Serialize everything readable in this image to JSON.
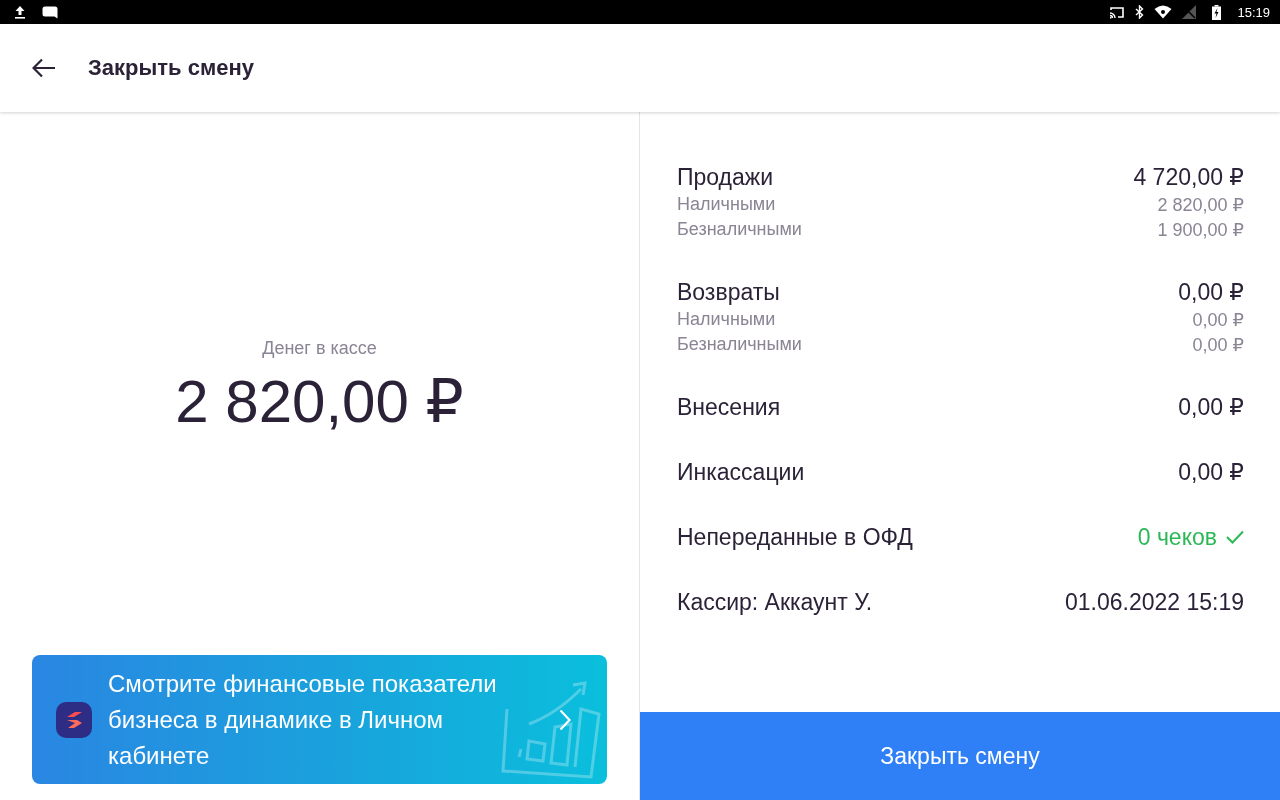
{
  "status_bar": {
    "time": "15:19"
  },
  "header": {
    "title": "Закрыть смену"
  },
  "cash": {
    "label": "Денег в кассе",
    "amount": "2 820,00 ₽"
  },
  "promo": {
    "text": "Смотрите финансовые показатели бизнеса в динамике в Личном кабинете"
  },
  "summary": [
    {
      "kind": "line",
      "label": "Продажи",
      "value": "4 720,00 ₽",
      "details": [
        {
          "label": "Наличными",
          "value": "2 820,00 ₽"
        },
        {
          "label": "Безналичными",
          "value": "1 900,00 ₽"
        }
      ]
    },
    {
      "kind": "line",
      "label": "Возвраты",
      "value": "0,00 ₽",
      "details": [
        {
          "label": "Наличными",
          "value": "0,00 ₽"
        },
        {
          "label": "Безналичными",
          "value": "0,00 ₽"
        }
      ]
    },
    {
      "kind": "line",
      "label": "Внесения",
      "value": "0,00 ₽"
    },
    {
      "kind": "line",
      "label": "Инкассации",
      "value": "0,00 ₽"
    },
    {
      "kind": "status",
      "label": "Непереданные в ОФД",
      "value": "0 чеков",
      "ok": true
    },
    {
      "kind": "line",
      "label": "Кассир: Аккаунт У.",
      "value": "01.06.2022 15:19"
    }
  ],
  "close_button": {
    "label": "Закрыть смену"
  }
}
